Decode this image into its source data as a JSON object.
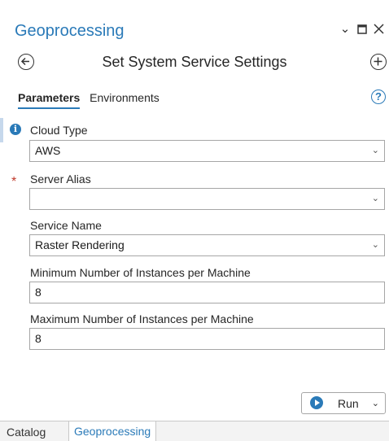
{
  "app": {
    "title": "Geoprocessing",
    "accent_color": "#2a7ab8"
  },
  "window_controls": {
    "dropdown_icon": "chevron-down-icon",
    "maximize_icon": "maximize-icon",
    "close_icon": "close-icon"
  },
  "tool": {
    "title": "Set System Service Settings",
    "back_icon": "back-arrow-icon",
    "add_icon": "add-circle-icon"
  },
  "tabs": [
    {
      "label": "Parameters",
      "active": true
    },
    {
      "label": "Environments",
      "active": false
    }
  ],
  "help_glyph": "?",
  "params": {
    "cloud_type": {
      "label": "Cloud Type",
      "value": "AWS"
    },
    "server_alias": {
      "label": "Server Alias",
      "value": ""
    },
    "service_name": {
      "label": "Service Name",
      "value": "Raster Rendering"
    },
    "min_instances": {
      "label": "Minimum Number of Instances per Machine",
      "value": "8"
    },
    "max_instances": {
      "label": "Maximum Number of Instances per Machine",
      "value": "8"
    }
  },
  "run_button": {
    "label": "Run"
  },
  "bottom_tabs": [
    {
      "label": "Catalog",
      "active": false
    },
    {
      "label": "Geoprocessing",
      "active": true
    }
  ]
}
